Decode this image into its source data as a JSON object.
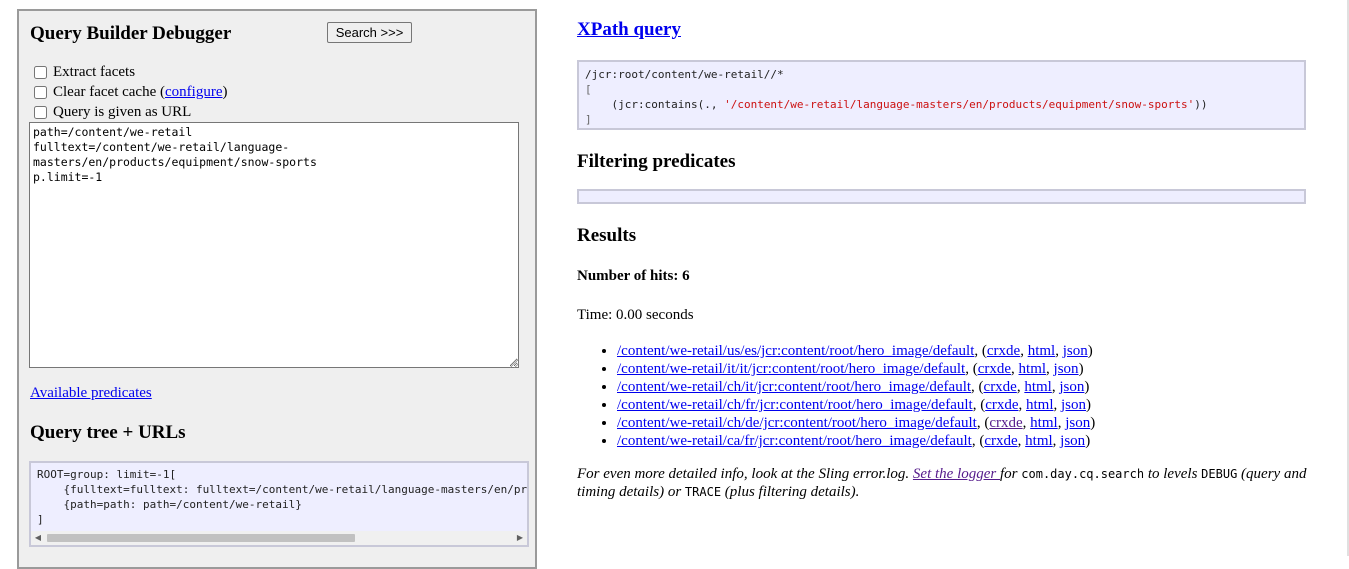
{
  "left": {
    "title": "Query Builder Debugger",
    "search_button": "Search >>>",
    "extract_facets": "Extract facets",
    "clear_facet_cache": "Clear facet cache (",
    "configure_link": "configure",
    "clear_facet_close": ")",
    "query_as_url": "Query is given as URL",
    "query_text": "path=/content/we-retail\nfulltext=/content/we-retail/language-masters/en/products/equipment/snow-sports\np.limit=-1",
    "available_predicates": "Available predicates",
    "query_tree_title": "Query tree + URLs",
    "query_tree_text": "ROOT=group: limit=-1[\n    {fulltext=fulltext: fulltext=/content/we-retail/language-masters/en/products/equipment/snow-sports}\n    {path=path: path=/content/we-retail}\n]"
  },
  "right": {
    "xpath_title": "XPath query",
    "xpath_line1": "/jcr:root/content/we-retail//*",
    "xpath_open": "[",
    "xpath_fn": "    (jcr:contains(., ",
    "xpath_str": "'/content/we-retail/language-masters/en/products/equipment/snow-sports'",
    "xpath_fn_close": "))",
    "xpath_close": "]",
    "filtering_title": "Filtering predicates",
    "results_title": "Results",
    "hits_label": "Number of hits: 6",
    "time_label": "Time: 0.00 seconds",
    "results": [
      {
        "path": "/content/we-retail/us/es/jcr:content/root/hero_image/default"
      },
      {
        "path": "/content/we-retail/it/it/jcr:content/root/hero_image/default"
      },
      {
        "path": "/content/we-retail/ch/it/jcr:content/root/hero_image/default"
      },
      {
        "path": "/content/we-retail/ch/fr/jcr:content/root/hero_image/default"
      },
      {
        "path": "/content/we-retail/ch/de/jcr:content/root/hero_image/default"
      },
      {
        "path": "/content/we-retail/ca/fr/jcr:content/root/hero_image/default"
      }
    ],
    "link_crxde": "crxde",
    "link_html": "html",
    "link_json": "json",
    "note_prefix": "For even more detailed info, look at the Sling error.log. ",
    "note_link": "Set the logger ",
    "note_for": "for ",
    "note_pkg": "com.day.cq.search",
    "note_levels": " to levels ",
    "note_debug": "DEBUG",
    "note_mid": " (query and timing details) or ",
    "note_trace": "TRACE",
    "note_suffix": " (plus filtering details)."
  }
}
